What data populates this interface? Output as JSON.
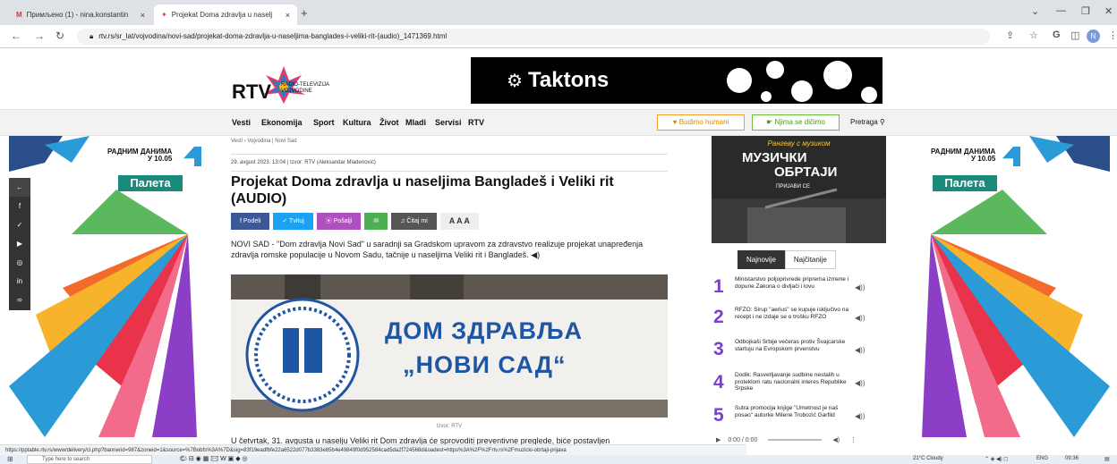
{
  "browser": {
    "tabs": [
      {
        "label": "Примљено (1) - nina.konstantin",
        "close": "×"
      },
      {
        "label": "Projekat Doma zdravlja u naselj",
        "close": "×"
      }
    ],
    "new_tab": "+",
    "url": "rtv.rs/sr_lat/vojvodina/novi-sad/projekat-doma-zdravlja-u-naseljima-banglades-i-veliki-rit-(audio)_1471369.html",
    "controls": {
      "minimize": "⌄",
      "min2": "—",
      "restore": "❐",
      "close": "✕"
    },
    "profile": "N"
  },
  "header": {
    "logo_text": "RTV",
    "logo_sub_line1": "RADIO-TELEVIZIJA",
    "logo_sub_line2": "VOJVODINE",
    "banner_text": "Taktons"
  },
  "menu": {
    "items": [
      "Vesti",
      "Ekonomija",
      "Sport",
      "Kultura",
      "Život",
      "Mladi",
      "Servisi",
      "RTV"
    ],
    "btn_humani": "♥ Budimo humani",
    "btn_nisi": "☛ Njima se dičimo",
    "search": "Pretraga"
  },
  "side": {
    "radnim_line1": "РАДНИМ ДАНИМА",
    "radnim_line2": "У 10.05",
    "paleta": "Палета"
  },
  "article": {
    "breadcrumb": "Vesti › Vojvodina | Novi Sad",
    "meta": "29. avgust 2023. 13:04 | Izvor: RTV (Aleksandar Mladenović)",
    "title": "Projekat Doma zdravlja u naseljima Bangladeš i Veliki rit (AUDIO)",
    "share": [
      "f  Podeli",
      "✓  Tvituj",
      "⦿  Pošalji",
      "✉",
      "♫  Čitaj mi",
      "A A A"
    ],
    "lead": "NOVI SAD - \"Dom zdravlja Novi Sad\" u saradnji sa Gradskom upravom za zdravstvo realizuje projekat unapređenja zdravlja romske populacije u Novom Sadu, tačnije u naseljima Veliki rit i Bangladeš.",
    "photo_line1": "ДОМ ЗДРАВЉА",
    "photo_line2": "„НОВИ САД“",
    "caption": "Izvor: RTV",
    "body_start": "U četvrtak, 31. avgusta u naselju Veliki rit Dom zdravlja će sprovoditi preventivne preglede, biće postavljen"
  },
  "right": {
    "banner_top": "Рангеву с музиком",
    "banner_main1": "МУЗИЧКИ",
    "banner_main2": "ОБРТАЈИ",
    "banner_cta": "ПРИЈАВИ СЕ",
    "tab_latest": "Najnovije",
    "tab_read": "Najčitanije",
    "news": [
      {
        "num": "1",
        "text": "Ministarstvo poljoprivrede priprema izmene i dopune Zakona o divljači i lovu"
      },
      {
        "num": "2",
        "text": "RFZO: Sirup \"aerius\" se kupuje isključivo na recept i ne izdaje se o trošku RFZO"
      },
      {
        "num": "3",
        "text": "Odbojkaši Srbije večeras protiv Švajcarske startuju na Evropskom prvenstvu"
      },
      {
        "num": "4",
        "text": "Dodik: Rasvetljavanje sudbine nestalih u proteklom ratu nacionalni interes Republike Srpske"
      },
      {
        "num": "5",
        "text": "Sutra promocija knjige \"Umetnost je naš posao\" autorke Milene Trobozić Garfild"
      }
    ],
    "player_time": "0:00 / 0:00"
  },
  "status_url": "https://pptable.rtv.rs/www/delivery/cl.php?bannerid=987&zoneid=1&source=%7Bobfs%3A%7D&sig=83f19eadfbfe22a6522d077b3383e85b4e49849f0d952584cad5da2f724568d&oadest=https%3A%2F%2Frtv.rs%2Fmuzicki-obrtaji-prijava",
  "taskbar": {
    "search_placeholder": "Type here to search",
    "weather": "21°C Cloudy",
    "lang": "ENG",
    "time": "09:36"
  },
  "colors": {
    "accent_purple": "#7a3fd0",
    "facebook": "#3b5998",
    "twitter": "#1da1f2",
    "send": "#b04fbf",
    "email": "#4caf50",
    "listen": "#555555"
  }
}
